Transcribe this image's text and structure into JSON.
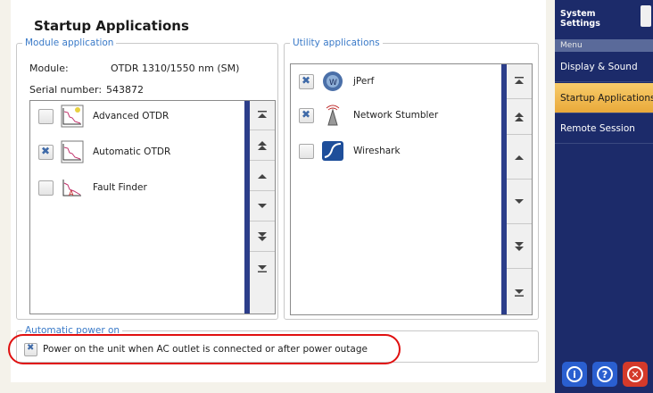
{
  "page": {
    "title": "Startup Applications"
  },
  "module_group": {
    "legend": "Module application",
    "module_label": "Module:",
    "module_value": "OTDR 1310/1550 nm (SM)",
    "serial_label": "Serial number:",
    "serial_value": "543872",
    "items": [
      {
        "label": "Advanced OTDR",
        "checked": false,
        "icon": "advanced-otdr-icon"
      },
      {
        "label": "Automatic OTDR",
        "checked": true,
        "icon": "automatic-otdr-icon"
      },
      {
        "label": "Fault Finder",
        "checked": false,
        "icon": "fault-finder-icon"
      }
    ]
  },
  "utility_group": {
    "legend": "Utility applications",
    "items": [
      {
        "label": "jPerf",
        "checked": true,
        "icon": "jperf-icon"
      },
      {
        "label": "Network Stumbler",
        "checked": true,
        "icon": "network-stumbler-icon"
      },
      {
        "label": "Wireshark",
        "checked": false,
        "icon": "wireshark-icon"
      }
    ]
  },
  "scroll_buttons": [
    "scroll-to-top",
    "page-up",
    "line-up",
    "line-down",
    "page-down",
    "scroll-to-bottom"
  ],
  "power_group": {
    "legend": "Automatic power on",
    "checkbox_label": "Power on the unit when AC outlet is connected or after power outage",
    "checked": true
  },
  "sidebar": {
    "title": "System\nSettings",
    "menu_header": "Menu",
    "items": [
      {
        "label": "Display & Sound",
        "active": false
      },
      {
        "label": "Startup Applications",
        "active": true
      },
      {
        "label": "Remote Session",
        "active": false
      }
    ],
    "footer_buttons": [
      {
        "icon": "info-icon",
        "glyph": "i",
        "color": "#2a5fd0"
      },
      {
        "icon": "help-icon",
        "glyph": "?",
        "color": "#2a5fd0"
      },
      {
        "icon": "close-icon",
        "glyph": "✕",
        "color": "#d43a2a"
      }
    ]
  },
  "colors": {
    "accent": "#2c3e8a",
    "sidebar": "#1c2b6a",
    "active_menu": "#f0b040",
    "legend": "#3a7ac8",
    "highlight": "#e01010"
  }
}
